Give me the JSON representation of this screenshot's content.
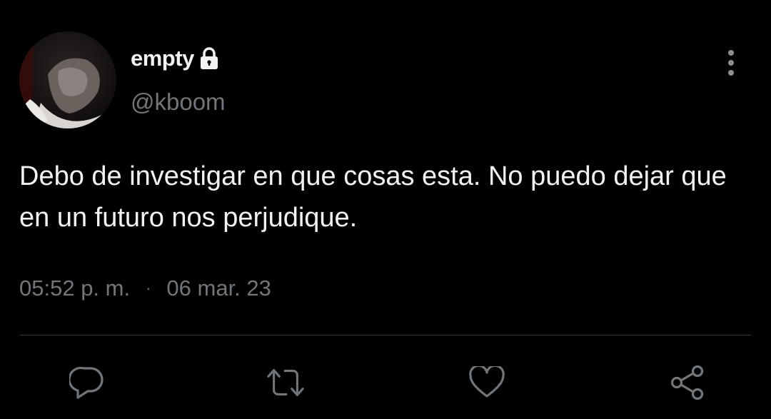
{
  "user": {
    "display_name": "empty",
    "handle": "@kboom",
    "protected": true
  },
  "tweet": {
    "text": "Debo de investigar en que cosas esta. No puedo dejar que en un futuro nos perjudique.",
    "time": "05:52 p. m.",
    "separator": "·",
    "date": "06 mar. 23"
  },
  "icons": {
    "lock": "lock-icon",
    "more": "more-vertical-icon",
    "reply": "reply-icon",
    "retweet": "retweet-icon",
    "like": "heart-icon",
    "share": "share-icon"
  },
  "colors": {
    "background": "#000000",
    "text": "#f2f2f2",
    "secondary": "#71767b",
    "divider": "#2f3336"
  }
}
